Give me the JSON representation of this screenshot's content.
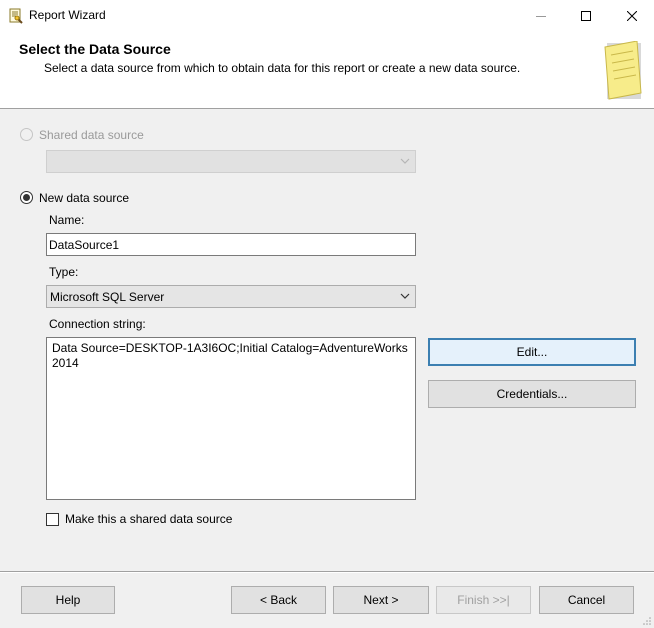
{
  "window": {
    "title": "Report Wizard",
    "icon": "report-wizard-icon"
  },
  "header": {
    "title": "Select the Data Source",
    "subtitle": "Select a data source from which to obtain data for this report or create a new data source.",
    "icon": "notepad-icon"
  },
  "shared_source": {
    "label": "Shared data source",
    "selected_value": "",
    "enabled": false
  },
  "new_source": {
    "label": "New data source",
    "selected": true,
    "name_label": "Name:",
    "name_value": "DataSource1",
    "type_label": "Type:",
    "type_value": "Microsoft SQL Server",
    "conn_label": "Connection string:",
    "conn_value": "Data Source=DESKTOP-1A3I6OC;Initial Catalog=AdventureWorks2014",
    "edit_button": "Edit...",
    "credentials_button": "Credentials...",
    "shared_checkbox_label": "Make this a shared data source"
  },
  "footer": {
    "help": "Help",
    "back": "< Back",
    "next": "Next >",
    "finish": "Finish >>|",
    "cancel": "Cancel"
  },
  "colors": {
    "accent_border": "#3c7fb1",
    "header_bg": "#ffffff",
    "body_bg": "#f0f0f0"
  }
}
